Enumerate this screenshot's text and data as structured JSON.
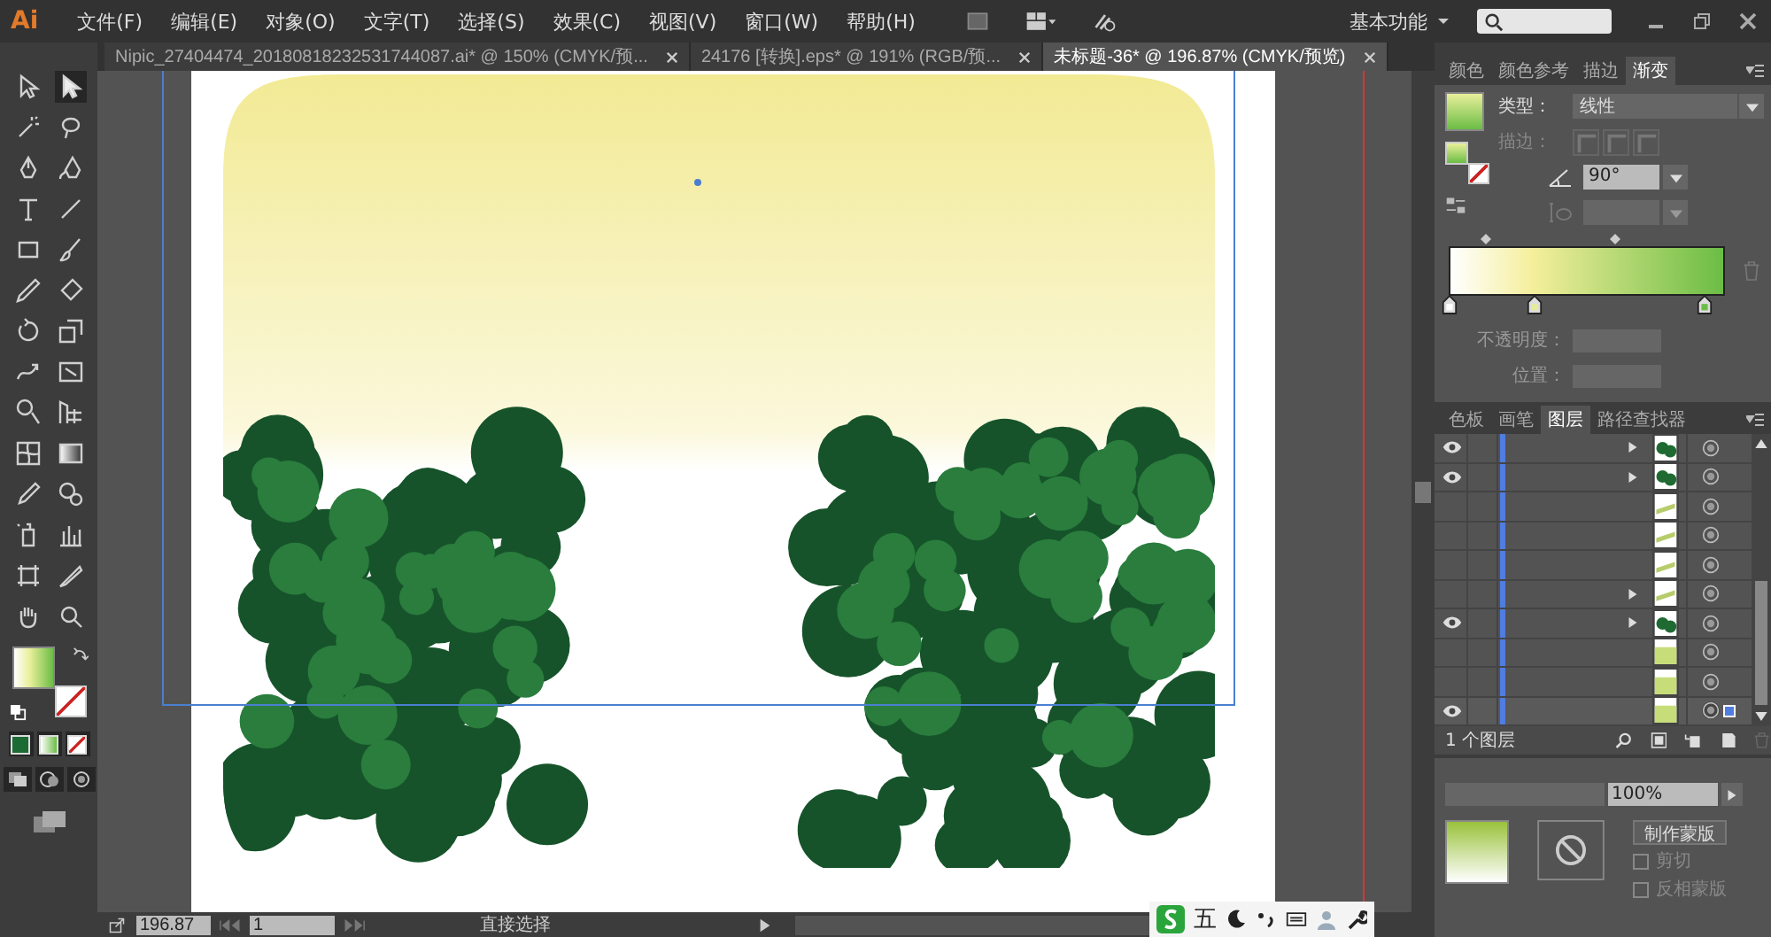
{
  "app": {
    "logo": "Ai"
  },
  "menu": [
    "文件(F)",
    "编辑(E)",
    "对象(O)",
    "文字(T)",
    "选择(S)",
    "效果(C)",
    "视图(V)",
    "窗口(W)",
    "帮助(H)"
  ],
  "workspace": "基本功能",
  "tabs": [
    {
      "label": "Nipic_27404474_20180818232531744087.ai* @ 150% (CMYK/预...",
      "selected": false
    },
    {
      "label": "24176 [转换].eps* @ 191% (RGB/预...",
      "selected": false
    },
    {
      "label": "未标题-36* @ 196.87% (CMYK/预览)",
      "selected": true
    }
  ],
  "gradient_panel": {
    "tabs": [
      {
        "label": "颜色",
        "selected": false
      },
      {
        "label": "颜色参考",
        "selected": false
      },
      {
        "label": "描边",
        "selected": false
      },
      {
        "label": "渐变",
        "selected": true
      }
    ],
    "type_label": "类型：",
    "type_value": "线性",
    "stroke_label": "描边：",
    "angle_value": "90°",
    "opacity_label": "不透明度：",
    "position_label": "位置："
  },
  "layers_panel": {
    "tabs": [
      {
        "label": "色板",
        "selected": false
      },
      {
        "label": "画笔",
        "selected": false
      },
      {
        "label": "图层",
        "selected": true
      },
      {
        "label": "路径查找器",
        "selected": false
      }
    ],
    "layers": [
      {
        "visible": true,
        "expandable": true,
        "kind": "bush",
        "selected": false
      },
      {
        "visible": true,
        "expandable": true,
        "kind": "bush",
        "selected": false
      },
      {
        "visible": false,
        "expandable": false,
        "kind": "stripe",
        "selected": false
      },
      {
        "visible": false,
        "expandable": false,
        "kind": "stripe",
        "selected": false
      },
      {
        "visible": false,
        "expandable": false,
        "kind": "stripe",
        "selected": false
      },
      {
        "visible": false,
        "expandable": true,
        "kind": "stripe",
        "selected": false
      },
      {
        "visible": true,
        "expandable": true,
        "kind": "bush",
        "selected": false
      },
      {
        "visible": false,
        "expandable": false,
        "kind": "fill",
        "selected": false
      },
      {
        "visible": false,
        "expandable": false,
        "kind": "fill",
        "selected": false
      },
      {
        "visible": true,
        "expandable": false,
        "kind": "fill",
        "selected": true
      }
    ],
    "count": "1 个图层"
  },
  "transparency_panel": {
    "opacity": "100%",
    "make_mask": "制作蒙版",
    "clip": {
      "label": "剪切",
      "checked": false
    },
    "invert": {
      "label": "反相蒙版",
      "checked": false
    }
  },
  "status_bar": {
    "zoom": "196.87",
    "page": "1",
    "tool": "直接选择"
  },
  "ime_bar": {
    "label": "五"
  }
}
